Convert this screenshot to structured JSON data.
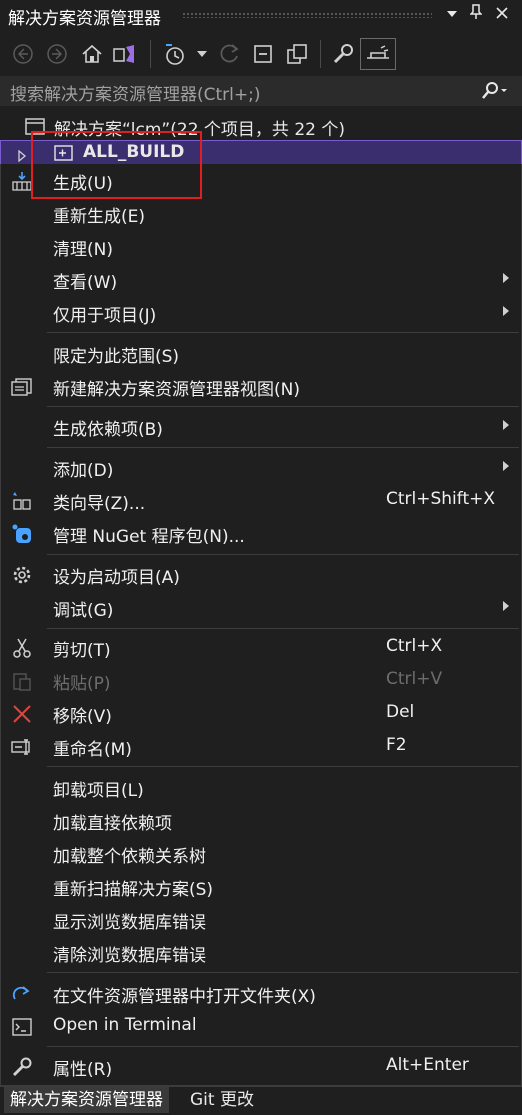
{
  "window": {
    "title": "解决方案资源管理器"
  },
  "toolbar": {
    "buttons": [
      "back-icon",
      "forward-icon",
      "home-icon",
      "vs-switch-icon",
      "pending-changes-icon",
      "dropdown-chevron-icon",
      "refresh-icon",
      "collapse-all-icon",
      "show-all-files-icon",
      "properties-icon",
      "preview-icon"
    ]
  },
  "search": {
    "placeholder": "搜索解决方案资源管理器(Ctrl+;)"
  },
  "tree": {
    "solution_label": "解决方案“lcm”(22 个项目，共 22 个)",
    "selected_project": "ALL_BUILD"
  },
  "menu": {
    "build": "生成(U)",
    "rebuild": "重新生成(E)",
    "clean": "清理(N)",
    "view": "查看(W)",
    "project_only": "仅用于项目(J)",
    "scope_to_this": "限定为此范围(S)",
    "new_view": "新建解决方案资源管理器视图(N)",
    "build_deps": "生成依赖项(B)",
    "add": "添加(D)",
    "class_wizard": "类向导(Z)...",
    "class_wizard_sc": "Ctrl+Shift+X",
    "nuget": "管理 NuGet 程序包(N)...",
    "set_startup": "设为启动项目(A)",
    "debug": "调试(G)",
    "cut": "剪切(T)",
    "cut_sc": "Ctrl+X",
    "paste": "粘贴(P)",
    "paste_sc": "Ctrl+V",
    "remove": "移除(V)",
    "remove_sc": "Del",
    "rename": "重命名(M)",
    "rename_sc": "F2",
    "unload": "卸载项目(L)",
    "load_direct": "加载直接依赖项",
    "load_tree": "加载整个依赖关系树",
    "rescan": "重新扫描解决方案(S)",
    "show_db_errors": "显示浏览数据库错误",
    "clear_db_errors": "清除浏览数据库错误",
    "open_folder": "在文件资源管理器中打开文件夹(X)",
    "open_terminal": "Open in Terminal",
    "properties": "属性(R)",
    "properties_sc": "Alt+Enter"
  },
  "bottom_tabs": {
    "active": "解决方案资源管理器",
    "other": "Git 更改"
  },
  "colors": {
    "background": "#1f1f1f",
    "selected_row": "#3a2e6f",
    "highlight_box": "#e02020",
    "accent": "#7a5ccf"
  }
}
